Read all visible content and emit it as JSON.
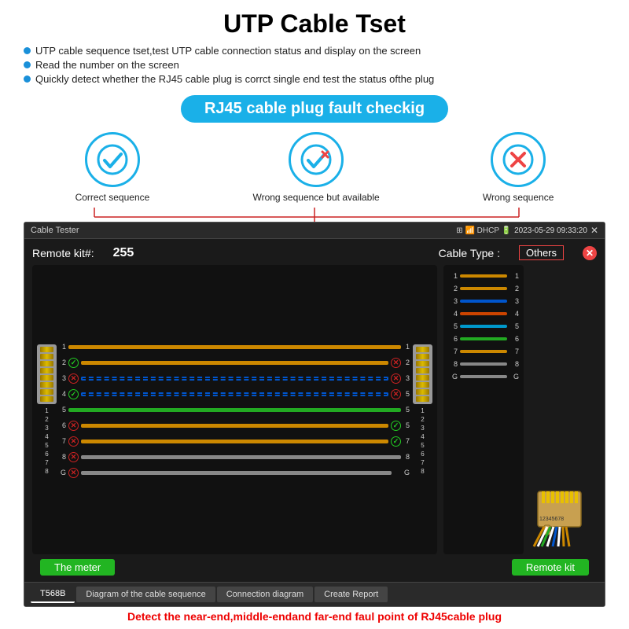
{
  "title": "UTP Cable Tset",
  "bullets": [
    "UTP cable sequence tset,test UTP cable connection status and display on the screen",
    "Read the number on the screen",
    "Quickly detect whether the RJ45 cable plug is corrct single end test the status ofthe plug"
  ],
  "banner": "RJ45 cable plug fault checkig",
  "icons": [
    {
      "label": "Correct sequence",
      "symbol": "✓",
      "type": "check"
    },
    {
      "label": "Wrong sequence but available",
      "symbol": "✓",
      "type": "check-x"
    },
    {
      "label": "Wrong sequence",
      "symbol": "✕",
      "type": "x"
    }
  ],
  "window": {
    "title": "Cable Tester",
    "datetime": "2023-05-29 09:33:20",
    "remote_kit_label": "Remote kit#:",
    "remote_kit_value": "255",
    "cable_type_label": "Cable Type :",
    "cable_type_value": "Others",
    "meter_label": "The meter",
    "remote_kit_btn": "Remote kit",
    "tabs": [
      "T568B",
      "Diagram of the cable sequence",
      "Connection diagram",
      "Create Report"
    ],
    "wires": [
      {
        "num": "1",
        "color": "#cc8800",
        "left_icon": "",
        "right_icon": ""
      },
      {
        "num": "2",
        "color": "#cc8800",
        "left_icon": "check",
        "right_icon": "x"
      },
      {
        "num": "3",
        "color": "#0055cc",
        "left_icon": "x",
        "right_icon": "x",
        "dashed": true
      },
      {
        "num": "4",
        "color": "#0055cc",
        "left_icon": "check",
        "right_icon": "x",
        "dashed": true
      },
      {
        "num": "5",
        "color": "#22aa22",
        "left_icon": "",
        "right_icon": ""
      },
      {
        "num": "6",
        "color": "#cc8800",
        "left_icon": "x",
        "right_icon": "check"
      },
      {
        "num": "7",
        "color": "#cc8800",
        "left_icon": "x",
        "right_icon": "check"
      },
      {
        "num": "8",
        "color": "#888888",
        "left_icon": "x",
        "right_icon": ""
      },
      {
        "num": "G",
        "color": "#888888",
        "left_icon": "x",
        "right_icon": "x"
      }
    ],
    "remote_wires": [
      {
        "num": "1",
        "color": "#cc8800"
      },
      {
        "num": "2",
        "color": "#cc8800"
      },
      {
        "num": "3",
        "color": "#0055cc"
      },
      {
        "num": "4",
        "color": "#cc4400"
      },
      {
        "num": "5",
        "color": "#0099cc"
      },
      {
        "num": "6",
        "color": "#22aa22"
      },
      {
        "num": "7",
        "color": "#cc8800"
      },
      {
        "num": "8",
        "color": "#888888"
      },
      {
        "num": "G",
        "color": "#888888"
      }
    ]
  },
  "bottom_text": "Detect the near-end,middle-endand far-end faul point of RJ45cable plug"
}
